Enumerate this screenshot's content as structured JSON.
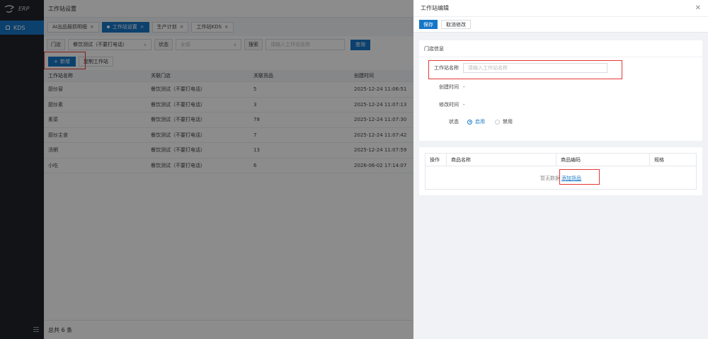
{
  "app": {
    "logo_text": "ERP"
  },
  "sidebar": {
    "items": [
      {
        "label": "KDS",
        "active": true
      }
    ]
  },
  "header": {
    "title": "工作站设置"
  },
  "tabs": [
    {
      "label": "AI出品报损明细",
      "active": false
    },
    {
      "label": "工作站设置",
      "active": true
    },
    {
      "label": "生产计划",
      "active": false
    },
    {
      "label": "工作站KDS",
      "active": false
    }
  ],
  "filters": {
    "store_label": "门店",
    "store_value": "餐饮测试（不要打电话）",
    "status_label": "状态",
    "status_value": "全部",
    "search_label": "搜索",
    "search_placeholder": "请输入工作站名称",
    "query_label": "查询"
  },
  "actions": {
    "new_label": "新增",
    "copy_label": "复制工作站"
  },
  "table": {
    "columns": [
      "工作站名称",
      "关联门店",
      "关联货品",
      "创建时间"
    ],
    "rows": [
      [
        "厨炒窗",
        "餐饮测试（不要打电话）",
        "5",
        "2025-12-24 11:06:51"
      ],
      [
        "厨炒素",
        "餐饮测试（不要打电话）",
        "3",
        "2025-12-24 11:07:13"
      ],
      [
        "素菜",
        "餐饮测试（不要打电话）",
        "78",
        "2025-12-24 11:07:30"
      ],
      [
        "厨炒主食",
        "餐饮测试（不要打电话）",
        "7",
        "2025-12-24 11:07:42"
      ],
      [
        "汤粥",
        "餐饮测试（不要打电话）",
        "13",
        "2025-12-24 11:07:59"
      ],
      [
        "小吃",
        "餐饮测试（不要打电话）",
        "6",
        "2026-06-02 17:14:07"
      ]
    ]
  },
  "footer": {
    "total_text": "总共 6 条"
  },
  "drawer": {
    "title": "工作站编辑",
    "save_label": "保存",
    "cancel_label": "取消修改",
    "section_title": "门店信息",
    "name_label": "工作站名称",
    "name_placeholder": "请输入工作站名称",
    "created_label": "创建时间",
    "created_value": "-",
    "modified_label": "修改时间",
    "modified_value": "-",
    "status_label": "状态",
    "status_enabled": "启用",
    "status_disabled": "禁用",
    "goods_columns": [
      "操作",
      "商品名称",
      "商品编码",
      "规格"
    ],
    "empty_text": "暂无数据",
    "add_goods_label": "添加货品"
  },
  "colors": {
    "accent": "#1677c8",
    "sidebar": "#1f2329",
    "highlight": "#e53935"
  }
}
